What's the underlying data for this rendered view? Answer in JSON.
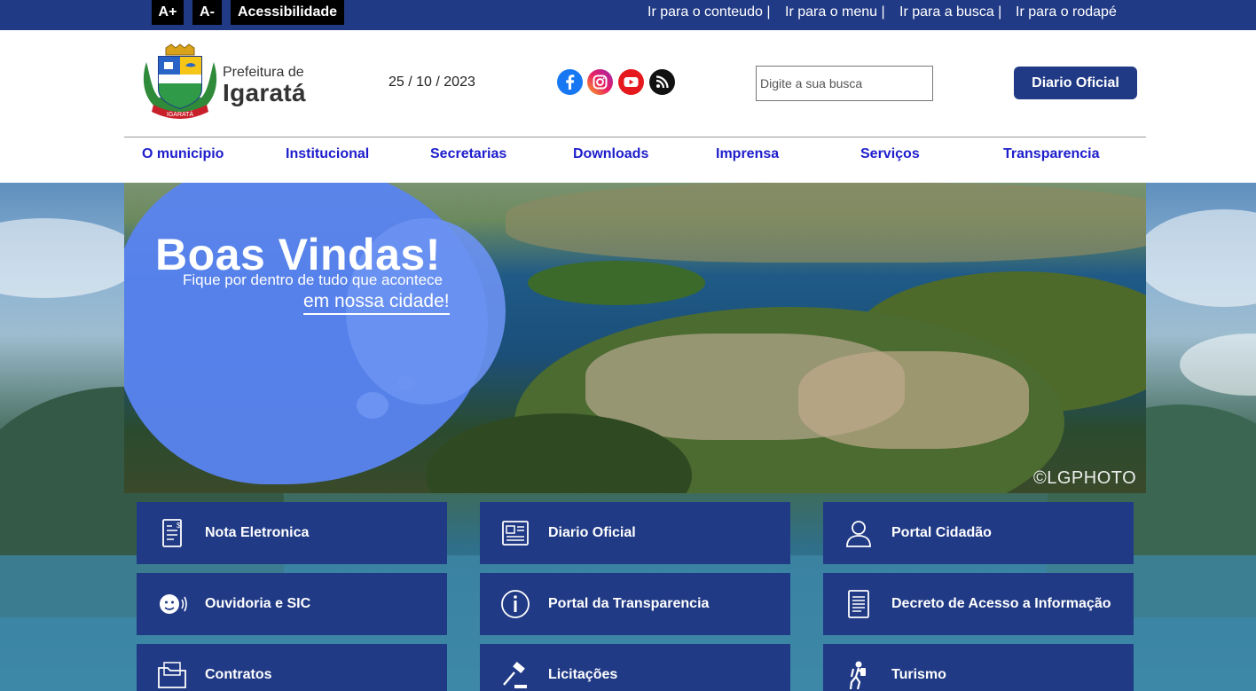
{
  "accessibility": {
    "increase_label": "A+",
    "decrease_label": "A-",
    "label": "Acessibilidade"
  },
  "skip_links": [
    "Ir para o conteudo |",
    "Ir para o menu |",
    "Ir para a busca |",
    "Ir para o rodapé"
  ],
  "header": {
    "logo_line1": "Prefeitura de",
    "logo_line2": "Igaratá",
    "date": "25 / 10 / 2023",
    "social": [
      "facebook-icon",
      "instagram-icon",
      "youtube-icon",
      "rss-icon"
    ],
    "search_placeholder": "Digite a sua busca",
    "diario_button": "Diario Oficial"
  },
  "nav": [
    "O municipio",
    "Institucional",
    "Secretarias",
    "Downloads",
    "Imprensa",
    "Serviços",
    "Transparencia"
  ],
  "hero": {
    "title": "Boas Vindas!",
    "subtitle1": "Fique por dentro de tudo que acontece",
    "subtitle2": "em nossa cidade!",
    "credit": "©LGPHOTO"
  },
  "tiles": [
    {
      "label": "Nota Eletronica",
      "icon": "invoice-icon"
    },
    {
      "label": "Diario Oficial",
      "icon": "newspaper-icon"
    },
    {
      "label": "Portal Cidadão",
      "icon": "user-icon"
    },
    {
      "label": "Ouvidoria e SIC",
      "icon": "speaking-person-icon"
    },
    {
      "label": "Portal da Transparencia",
      "icon": "info-icon"
    },
    {
      "label": "Decreto de Acesso a Informação",
      "icon": "document-icon"
    },
    {
      "label": "Contratos",
      "icon": "folder-icon"
    },
    {
      "label": "Licitações",
      "icon": "gavel-icon"
    },
    {
      "label": "Turismo",
      "icon": "hiker-icon"
    }
  ],
  "colors": {
    "primary": "#213a85",
    "nav_link": "#1d1dcc",
    "accessibility_bg": "#000000"
  }
}
